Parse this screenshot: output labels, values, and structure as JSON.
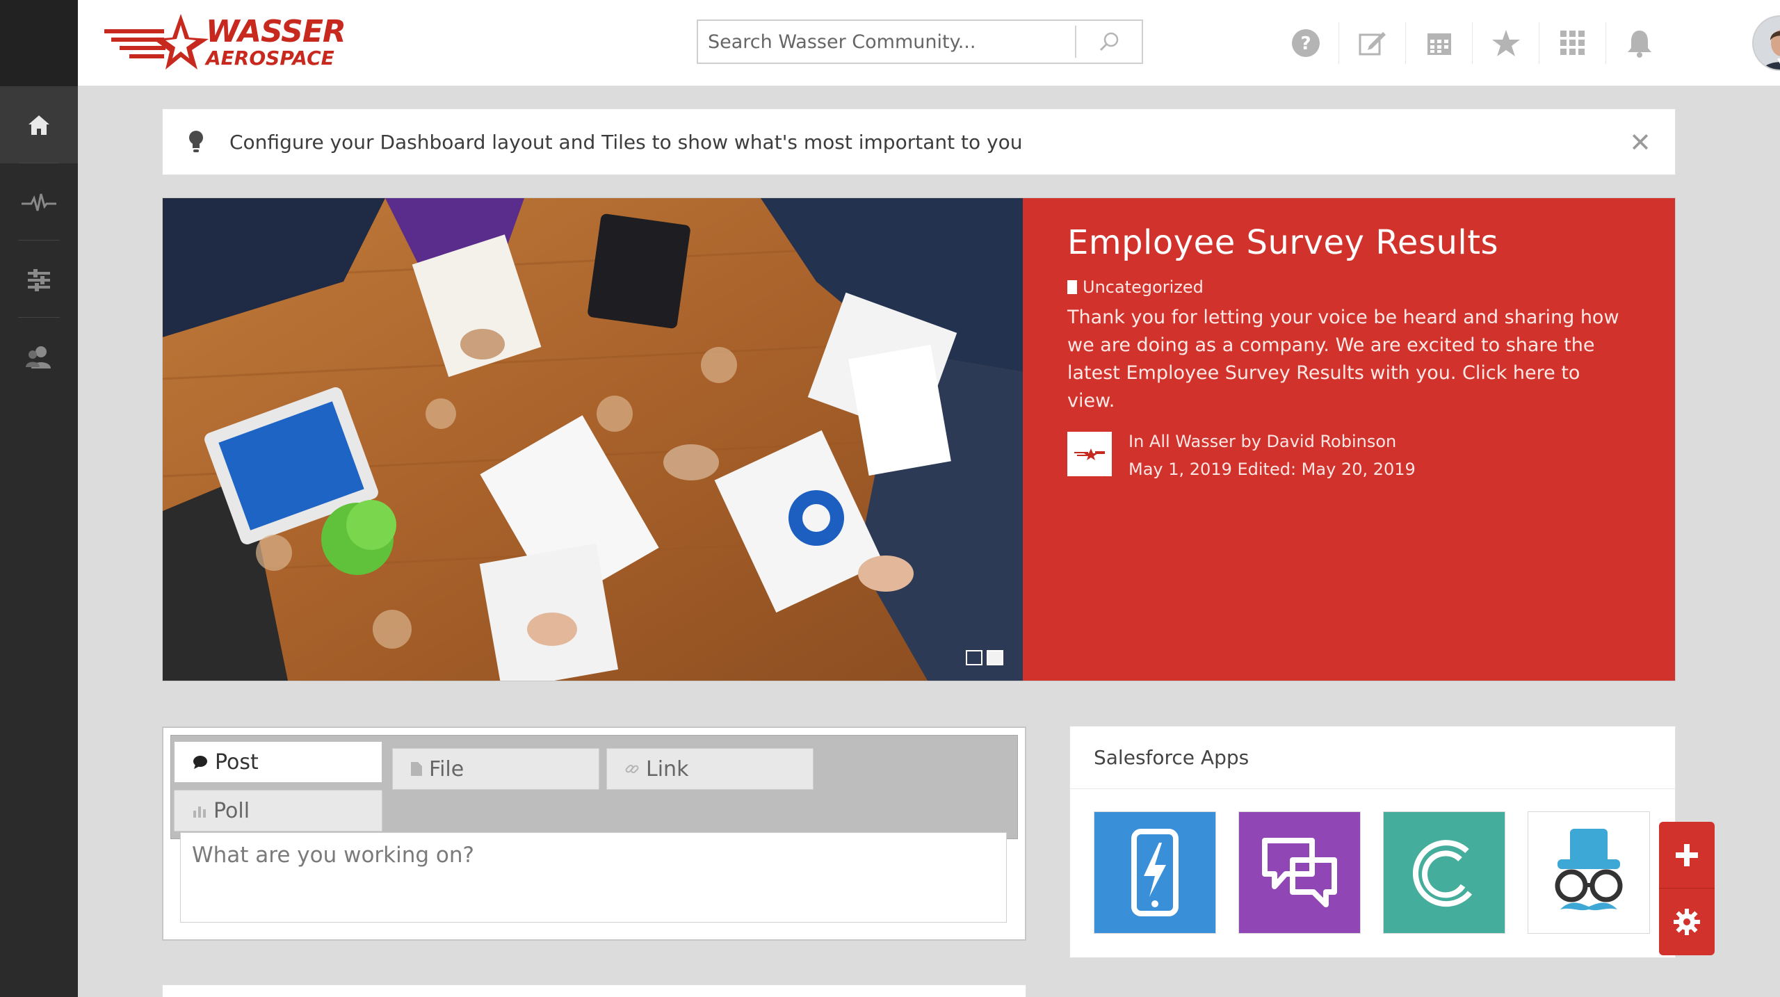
{
  "brand": {
    "name_line1": "WASSER",
    "name_line2": "AEROSPACE",
    "color": "#c8291f"
  },
  "search": {
    "placeholder": "Search Wasser Community..."
  },
  "header_icons": [
    "help-icon",
    "compose-icon",
    "calendar-icon",
    "favorites-icon",
    "apps-grid-icon",
    "notifications-icon"
  ],
  "sidebar": {
    "items": [
      {
        "icon": "home-icon",
        "active": true
      },
      {
        "icon": "activity-icon",
        "active": false
      },
      {
        "icon": "filters-icon",
        "active": false
      },
      {
        "icon": "people-icon",
        "active": false
      }
    ]
  },
  "tip": {
    "text": "Configure your Dashboard layout and Tiles to show what's most important to you",
    "close": "✕"
  },
  "hero": {
    "title": "Employee Survey Results",
    "category": "Uncategorized",
    "body": "Thank you for letting your voice be heard and sharing how we are doing as a company. We are excited to share the latest Employee Survey Results with you. Click here to view.",
    "meta_line1": "In All Wasser  by David Robinson",
    "meta_line2": "May 1, 2019 Edited: May 20, 2019",
    "panel_color": "#d1322b",
    "slides": {
      "count": 2,
      "active": 2
    }
  },
  "publisher": {
    "tabs": [
      {
        "label": "Post",
        "icon": "speech-bubble-icon"
      },
      {
        "label": "File",
        "icon": "document-icon"
      },
      {
        "label": "Link",
        "icon": "link-icon"
      },
      {
        "label": "Poll",
        "icon": "bar-chart-icon"
      }
    ],
    "placeholder": "What are you working on?"
  },
  "apps": {
    "title": "Salesforce Apps",
    "tiles": [
      {
        "name": "mobile-app",
        "color": "#3a8fd9"
      },
      {
        "name": "chat-app",
        "color": "#9146b6"
      },
      {
        "name": "c-app",
        "color": "#45ad9b"
      },
      {
        "name": "disguise-app",
        "color": "#ffffff"
      }
    ]
  },
  "fab": {
    "add": "+",
    "settings": "settings"
  }
}
